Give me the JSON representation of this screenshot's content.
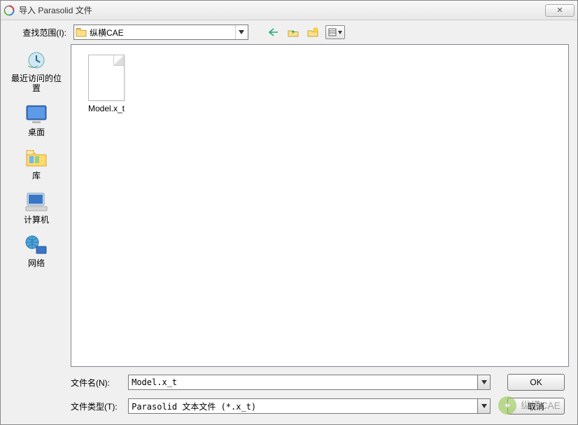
{
  "window": {
    "title": "导入 Parasolid 文件",
    "close": "✕"
  },
  "toolbar": {
    "look_in_label": "查找范围(I):",
    "look_in_value": "纵横CAE"
  },
  "places": {
    "recent": "最近访问的位置",
    "desktop": "桌面",
    "library": "库",
    "computer": "计算机",
    "network": "网络"
  },
  "files": {
    "item0": "Model.x_t"
  },
  "footer": {
    "name_label": "文件名(N):",
    "name_value": "Model.x_t",
    "type_label": "文件类型(T):",
    "type_value": "Parasolid 文本文件 (*.x_t)",
    "ok": "OK",
    "cancel": "取消"
  },
  "watermark": {
    "text": "纵横CAE"
  }
}
